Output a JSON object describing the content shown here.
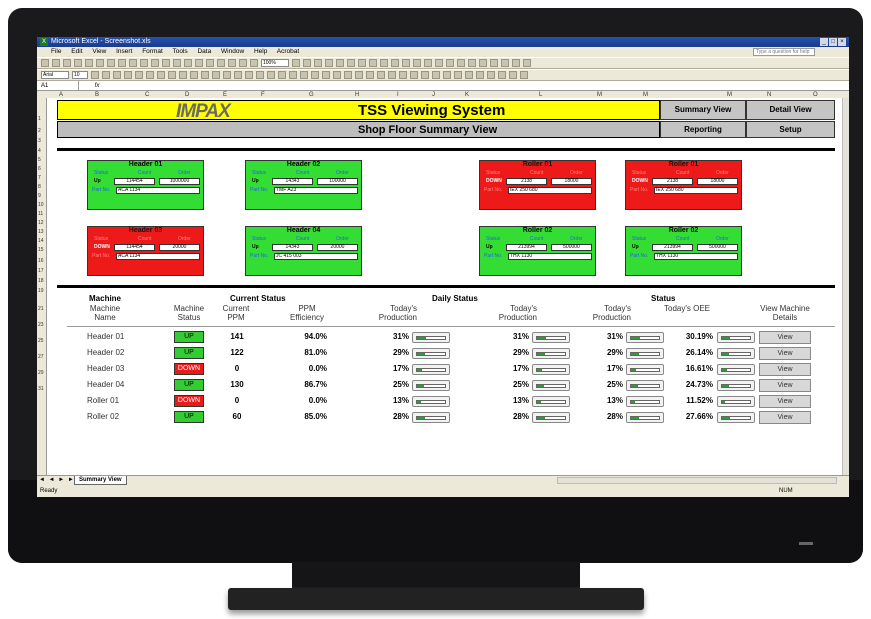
{
  "window": {
    "title": "Microsoft Excel - Screenshot.xls",
    "buttons": [
      "_",
      "□",
      "×"
    ]
  },
  "menu": {
    "items": [
      "File",
      "Edit",
      "View",
      "Insert",
      "Format",
      "Tools",
      "Data",
      "Window",
      "Help",
      "Acrobat"
    ],
    "help_placeholder": "Type a question for help"
  },
  "toolbar": {
    "font": "Arial",
    "size": "10",
    "zoom": "100%"
  },
  "formula_bar": {
    "name_box": "A1",
    "fx": "fx"
  },
  "columns": [
    "A",
    "B",
    "C",
    "D",
    "E",
    "F",
    "G",
    "H",
    "I",
    "J",
    "K",
    "L",
    "M",
    "N",
    "O"
  ],
  "rows": [
    "1",
    "2",
    "3",
    "4",
    "5",
    "6",
    "7",
    "8",
    "9",
    "10",
    "11",
    "12",
    "13",
    "14",
    "15",
    "16",
    "17",
    "18",
    "19",
    "21",
    "23",
    "25",
    "27",
    "29",
    "31"
  ],
  "header": {
    "logo": "IMPAX",
    "title": "TSS Viewing System",
    "subtitle": "Shop Floor Summary View",
    "nav": {
      "summary_view": "Summary View",
      "detail_view": "Detail View",
      "reporting": "Reporting",
      "setup": "Setup"
    }
  },
  "card_labels": {
    "status": "Status",
    "count": "Count",
    "order": "Order",
    "part_no": "Part No."
  },
  "cards": [
    {
      "title": "Header 01",
      "status": "Up",
      "count": "114454",
      "order": "1000000",
      "part": "ACA 1134",
      "state": "up"
    },
    {
      "title": "Header 02",
      "status": "Up",
      "count": "14343",
      "order": "100000",
      "part": "TMF A23",
      "state": "up"
    },
    {
      "title": "Roller 01",
      "status": "DOWN",
      "count": "2138",
      "order": "18000",
      "part": "IEX 250 680",
      "state": "down"
    },
    {
      "title": "Roller 01",
      "status": "DOWN",
      "count": "2138",
      "order": "18000",
      "part": "IEX 250 680",
      "state": "down"
    },
    {
      "title": "Header 03",
      "status": "DOWN",
      "count": "114454",
      "order": "20000",
      "part": "ACA 1134",
      "state": "down"
    },
    {
      "title": "Header 04",
      "status": "Up",
      "count": "14343",
      "order": "20000",
      "part": "JC 415 003",
      "state": "up"
    },
    {
      "title": "Roller 02",
      "status": "Up",
      "count": "213994",
      "order": "500000",
      "part": "THX 1130",
      "state": "up"
    },
    {
      "title": "Roller 02",
      "status": "Up",
      "count": "213994",
      "order": "500000",
      "part": "THX 1130",
      "state": "up"
    }
  ],
  "table": {
    "group_headers": {
      "machine": "Machine",
      "current_status": "Current Status",
      "daily_status": "Daily Status",
      "status": "Status"
    },
    "col_headers": {
      "machine_name": "Machine Name",
      "machine_status": "Machine Status",
      "current_ppm": "Current PPM",
      "ppm_efficiency": "PPM Efficiency",
      "todays_production_1": "Today's Production",
      "todays_production_2": "Today's Production",
      "todays_production_3": "Today's Production",
      "todays_oee": "Today's OEE",
      "view_details": "View Machine Details"
    },
    "rows": [
      {
        "name": "Header 01",
        "status": "UP",
        "state": "up",
        "ppm": "141",
        "eff": "94.0%",
        "p1": "31%",
        "p2": "31%",
        "p3": "31%",
        "oee": "30.19%",
        "fill1": 0.31,
        "fill2": 0.31,
        "fill3": 0.31,
        "fill4": 0.3019,
        "view": "View"
      },
      {
        "name": "Header 02",
        "status": "UP",
        "state": "up",
        "ppm": "122",
        "eff": "81.0%",
        "p1": "29%",
        "p2": "29%",
        "p3": "29%",
        "oee": "26.14%",
        "fill1": 0.29,
        "fill2": 0.29,
        "fill3": 0.29,
        "fill4": 0.2614,
        "view": "View"
      },
      {
        "name": "Header 03",
        "status": "DOWN",
        "state": "down",
        "ppm": "0",
        "eff": "0.0%",
        "p1": "17%",
        "p2": "17%",
        "p3": "17%",
        "oee": "16.61%",
        "fill1": 0.17,
        "fill2": 0.17,
        "fill3": 0.17,
        "fill4": 0.1661,
        "view": "View"
      },
      {
        "name": "Header 04",
        "status": "UP",
        "state": "up",
        "ppm": "130",
        "eff": "86.7%",
        "p1": "25%",
        "p2": "25%",
        "p3": "25%",
        "oee": "24.73%",
        "fill1": 0.25,
        "fill2": 0.25,
        "fill3": 0.25,
        "fill4": 0.2473,
        "view": "View"
      },
      {
        "name": "Roller 01",
        "status": "DOWN",
        "state": "down",
        "ppm": "0",
        "eff": "0.0%",
        "p1": "13%",
        "p2": "13%",
        "p3": "13%",
        "oee": "11.52%",
        "fill1": 0.13,
        "fill2": 0.13,
        "fill3": 0.13,
        "fill4": 0.1152,
        "view": "View"
      },
      {
        "name": "Roller 02",
        "status": "UP",
        "state": "up",
        "ppm": "60",
        "eff": "85.0%",
        "p1": "28%",
        "p2": "28%",
        "p3": "28%",
        "oee": "27.66%",
        "fill1": 0.28,
        "fill2": 0.28,
        "fill3": 0.28,
        "fill4": 0.2766,
        "view": "View"
      }
    ]
  },
  "sheet_tab": "Summary View",
  "sheet_nav": "◄ ◄ ► ►|",
  "status_bar": {
    "left": "Ready",
    "right": "NUM"
  },
  "colors": {
    "green": "#33dd33",
    "red": "#ee1a1a",
    "yellow": "#ffff00",
    "title_blue": "#2452b0"
  }
}
